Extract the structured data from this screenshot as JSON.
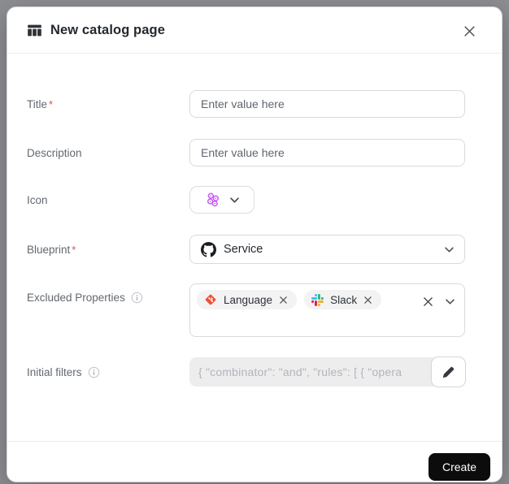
{
  "header": {
    "title": "New catalog page"
  },
  "fields": {
    "title": {
      "label": "Title",
      "required": "*",
      "placeholder": "Enter value here"
    },
    "description": {
      "label": "Description",
      "placeholder": "Enter value here"
    },
    "icon": {
      "label": "Icon",
      "selected_icon": "microservice-cluster-icon"
    },
    "blueprint": {
      "label": "Blueprint",
      "required": "*",
      "value": "Service",
      "value_icon": "github-icon"
    },
    "excluded_properties": {
      "label": "Excluded Properties",
      "chips": [
        {
          "label": "Language",
          "icon": "git-icon"
        },
        {
          "label": "Slack",
          "icon": "slack-icon"
        }
      ]
    },
    "initial_filters": {
      "label": "Initial filters",
      "value": "{  \"combinator\": \"and\",  \"rules\": [  {     \"opera"
    }
  },
  "footer": {
    "create_label": "Create"
  },
  "colors": {
    "accent_purple": "#C65BF0",
    "git_orange": "#F05033",
    "slack_blue": "#36C5F0",
    "slack_green": "#2EB67D",
    "slack_yellow": "#ECB22E",
    "slack_red": "#E01E5A",
    "button_bg": "#0C0C0D",
    "required_red": "#E5484D"
  }
}
